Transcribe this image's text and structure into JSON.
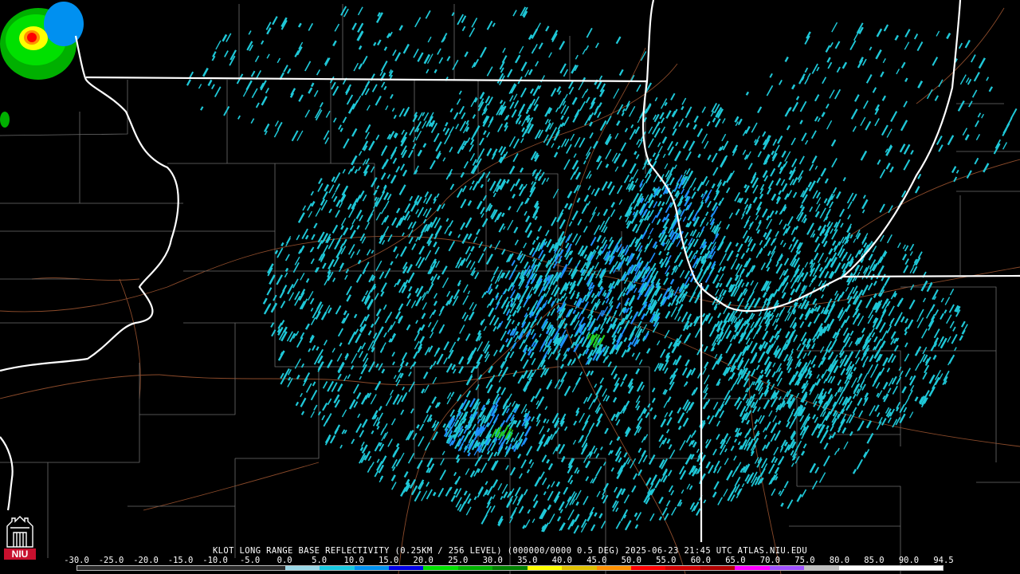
{
  "caption": "KLOT LONG RANGE BASE REFLECTIVITY (0.25KM / 256 LEVEL) (000000/0000 0.5 DEG) 2025-06-23 21:45 UTC  ATLAS.NIU.EDU",
  "logo": {
    "text": "NIU",
    "icon": "niu-tower-logo-icon",
    "color": "#c8102e"
  },
  "scale_ticks": [
    "-30.0",
    "-25.0",
    "-20.0",
    "-15.0",
    "-10.0",
    "-5.0",
    "0.0",
    "5.0",
    "10.0",
    "15.0",
    "20.0",
    "25.0",
    "30.0",
    "35.0",
    "40.0",
    "45.0",
    "50.0",
    "55.0",
    "60.0",
    "65.0",
    "70.0",
    "75.0",
    "80.0",
    "85.0",
    "90.0",
    "94.5"
  ],
  "colors": {
    "background": "#000000",
    "state_border": "#ffffff",
    "county_border": "#6e6e6e",
    "road": "#8a4a2a",
    "echo_light": "#1fc8d8",
    "echo_mid": "#1e90ff",
    "echo_green": "#22cc22"
  },
  "colorbar": [
    "#2b2b2b",
    "#2b2b2b",
    "#2b2b2b",
    "#2b2b2b",
    "#2b2b2b",
    "#2b2b2b",
    "#9ad7e6",
    "#18c8e0",
    "#0090f0",
    "#0000e8",
    "#00e000",
    "#00b000",
    "#008000",
    "#ffff00",
    "#e0c000",
    "#ff9000",
    "#ff0000",
    "#d00000",
    "#b00000",
    "#ff00ff",
    "#a050ff",
    "#c0c0c0",
    "#ffffff",
    "#ffffff",
    "#ffffff"
  ]
}
